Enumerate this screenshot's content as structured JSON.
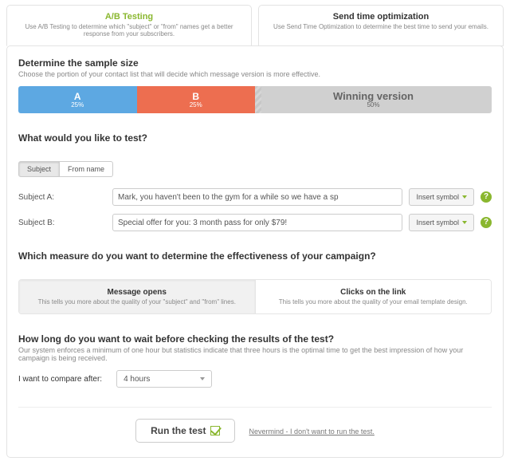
{
  "tabs": {
    "ab": {
      "title": "A/B Testing",
      "desc": "Use A/B Testing to determine which \"subject\" or \"from\" names get a better response from your subscribers."
    },
    "sto": {
      "title": "Send time optimization",
      "desc": "Use Send Time Optimization to determine the best time to send your emails."
    }
  },
  "sample": {
    "heading": "Determine the sample size",
    "subhead": "Choose the portion of your contact list that will decide which message version is more effective.",
    "a_label": "A",
    "a_pct": "25%",
    "b_label": "B",
    "b_pct": "25%",
    "win_label": "Winning version",
    "win_pct": "50%"
  },
  "test": {
    "heading": "What would you like to test?",
    "toggle_subject": "Subject",
    "toggle_from": "From name",
    "rowA_label": "Subject A:",
    "rowA_value": "Mark, you haven't been to the gym for a while so we have a sp",
    "rowB_label": "Subject B:",
    "rowB_value": "Special offer for you: 3 month pass for only $79!",
    "insert_label": "Insert symbol",
    "help_glyph": "?"
  },
  "measure": {
    "heading": "Which measure do you want to determine the effectiveness of your campaign?",
    "opens_title": "Message opens",
    "opens_desc": "This tells you more about the quality of your \"subject\" and \"from\" lines.",
    "clicks_title": "Clicks on the link",
    "clicks_desc": "This tells you more about the quality of your email template design."
  },
  "wait": {
    "heading": "How long do you want to wait before checking the results of the test?",
    "subhead": "Our system enforces a minimum of one hour but statistics indicate that three hours is the optimal time to get the best impression of how your campaign is being received.",
    "compare_label": "I want to compare after:",
    "compare_value": "4 hours"
  },
  "footer": {
    "run": "Run the test",
    "cancel": "Nevermind - I don't want to run the test."
  }
}
